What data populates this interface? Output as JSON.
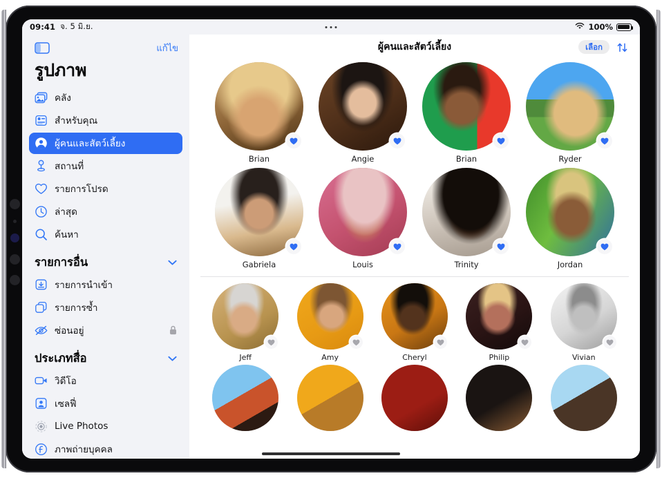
{
  "status_bar": {
    "time": "09:41",
    "date": "จ. 5 มิ.ย.",
    "battery_percent": "100%",
    "wifi_icon": "wifi-icon",
    "battery_icon": "battery-icon",
    "multitask_handle": "multitasking-dots"
  },
  "sidebar": {
    "toggle_icon": "sidebar-toggle-icon",
    "edit_label": "แก้ไข",
    "app_title": "รูปภาพ",
    "items": [
      {
        "label": "คลัง",
        "icon": "library-icon",
        "selected": false
      },
      {
        "label": "สำหรับคุณ",
        "icon": "for-you-icon",
        "selected": false
      },
      {
        "label": "ผู้คนและสัตว์เลี้ยง",
        "icon": "people-pets-icon",
        "selected": true
      },
      {
        "label": "สถานที่",
        "icon": "places-pin-icon",
        "selected": false
      },
      {
        "label": "รายการโปรด",
        "icon": "heart-icon",
        "selected": false
      },
      {
        "label": "ล่าสุด",
        "icon": "clock-icon",
        "selected": false
      },
      {
        "label": "ค้นหา",
        "icon": "search-icon",
        "selected": false
      }
    ],
    "sections": [
      {
        "title": "รายการอื่น",
        "chevron": "chevron-down-icon",
        "items": [
          {
            "label": "รายการนำเข้า",
            "icon": "import-icon",
            "trailing": ""
          },
          {
            "label": "รายการซ้ำ",
            "icon": "duplicates-icon",
            "trailing": ""
          },
          {
            "label": "ซ่อนอยู่",
            "icon": "hidden-eye-icon",
            "trailing": "lock-icon"
          }
        ]
      },
      {
        "title": "ประเภทสื่อ",
        "chevron": "chevron-down-icon",
        "items": [
          {
            "label": "วิดีโอ",
            "icon": "video-icon",
            "trailing": ""
          },
          {
            "label": "เซลฟี่",
            "icon": "selfie-icon",
            "trailing": ""
          },
          {
            "label": "Live Photos",
            "icon": "live-photos-icon",
            "trailing": ""
          },
          {
            "label": "ภาพถ่ายบุคคล",
            "icon": "portrait-icon",
            "trailing": ""
          }
        ]
      }
    ]
  },
  "main": {
    "title": "ผู้คนและสัตว์เลี้ยง",
    "select_label": "เลือก",
    "sort_icon": "sort-arrows-icon",
    "favorites": [
      {
        "name": "Brian",
        "favorite": true,
        "heart_icon": "heart-filled-icon"
      },
      {
        "name": "Angie",
        "favorite": true,
        "heart_icon": "heart-filled-icon"
      },
      {
        "name": "Brian",
        "favorite": true,
        "heart_icon": "heart-filled-icon"
      },
      {
        "name": "Ryder",
        "favorite": true,
        "heart_icon": "heart-filled-icon"
      },
      {
        "name": "Gabriela",
        "favorite": true,
        "heart_icon": "heart-filled-icon"
      },
      {
        "name": "Louis",
        "favorite": true,
        "heart_icon": "heart-filled-icon"
      },
      {
        "name": "Trinity",
        "favorite": true,
        "heart_icon": "heart-filled-icon"
      },
      {
        "name": "Jordan",
        "favorite": true,
        "heart_icon": "heart-filled-icon"
      }
    ],
    "others": [
      {
        "name": "Jeff",
        "favorite": false,
        "heart_icon": "heart-outline-icon"
      },
      {
        "name": "Amy",
        "favorite": false,
        "heart_icon": "heart-outline-icon"
      },
      {
        "name": "Cheryl",
        "favorite": false,
        "heart_icon": "heart-outline-icon"
      },
      {
        "name": "Philip",
        "favorite": false,
        "heart_icon": "heart-outline-icon"
      },
      {
        "name": "Vivian",
        "favorite": false,
        "heart_icon": "heart-outline-icon"
      }
    ],
    "partial_row_count": 5,
    "home_indicator": "home-indicator"
  },
  "colors": {
    "accent_blue": "#2f6df3",
    "link_blue": "#3478f6",
    "sidebar_bg": "#f2f3f7",
    "selected_text": "#ffffff",
    "heart_filled": "#2f6df3",
    "heart_empty": "#a0a0a6",
    "main_bg": "#ffffff"
  }
}
